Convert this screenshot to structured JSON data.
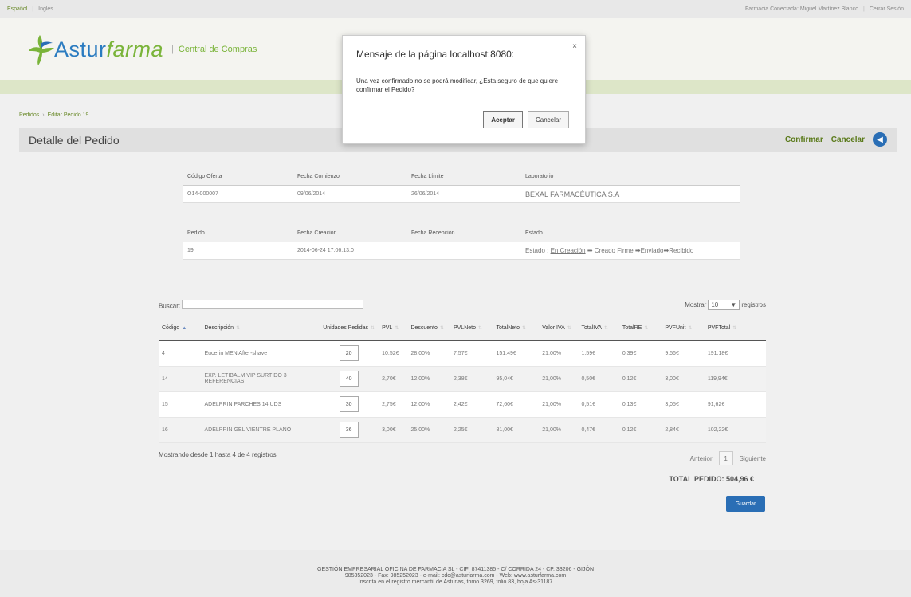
{
  "topbar": {
    "lang_es": "Español",
    "lang_en": "Inglés",
    "pharmacy_label": "Farmacia Conectada: Miguel Martínez Blanco",
    "logout": "Cerrar Sesión"
  },
  "header": {
    "logo_astur": "Astur",
    "logo_farma": "farma",
    "subtitle": "Central de Compras"
  },
  "breadcrumb": {
    "item1": "Pedidos",
    "item2": "Editar Pedido 19"
  },
  "titlebar": {
    "title": "Detalle del Pedido",
    "confirm": "Confirmar",
    "cancel": "Cancelar"
  },
  "offer": {
    "headers": [
      "Código Oferta",
      "Fecha Comienzo",
      "Fecha Límite",
      "Laboratorio"
    ],
    "values": [
      "O14-000007",
      "09/06/2014",
      "26/06/2014",
      "BEXAL FARMACÉUTICA S.A"
    ]
  },
  "order": {
    "headers": [
      "Pedido",
      "Fecha Creación",
      "Fecha Recepción",
      "Estado"
    ],
    "values": [
      "19",
      "2014-06-24 17:06:13.0",
      ""
    ],
    "estado_prefix": "Estado : ",
    "estado_current": "En Creación",
    "estado_rest": " ➡ Creado Firme ➡Enviado➡Recibido"
  },
  "table": {
    "search_label": "Buscar:",
    "show_label": "Mostrar",
    "show_value": "10",
    "records_label": "registros",
    "columns": [
      "Código",
      "Descripción",
      "Unidades Pedidas",
      "PVL",
      "Descuento",
      "PVLNeto",
      "TotalNeto",
      "Valor IVA",
      "TotalIVA",
      "TotalRE",
      "PVFUnit",
      "PVFTotal"
    ],
    "rows": [
      [
        "4",
        "Eucerin MEN After-shave",
        "20",
        "10,52€",
        "28,00%",
        "7,57€",
        "151,49€",
        "21,00%",
        "1,59€",
        "0,39€",
        "9,56€",
        "191,18€"
      ],
      [
        "14",
        "EXP. LETIBALM VIP SURTIDO 3 REFERENCIAS",
        "40",
        "2,70€",
        "12,00%",
        "2,38€",
        "95,04€",
        "21,00%",
        "0,50€",
        "0,12€",
        "3,00€",
        "119,94€"
      ],
      [
        "15",
        "ADELPRIN PARCHES 14 UDS",
        "30",
        "2,75€",
        "12,00%",
        "2,42€",
        "72,60€",
        "21,00%",
        "0,51€",
        "0,13€",
        "3,05€",
        "91,62€"
      ],
      [
        "16",
        "ADELPRIN GEL VIENTRE PLANO",
        "36",
        "3,00€",
        "25,00%",
        "2,25€",
        "81,00€",
        "21,00%",
        "0,47€",
        "0,12€",
        "2,84€",
        "102,22€"
      ]
    ],
    "info": "Mostrando desde 1 hasta 4 de 4 registros",
    "prev": "Anterior",
    "page": "1",
    "next": "Siguiente",
    "total": "TOTAL PEDIDO: 504,96 €",
    "save": "Guardar"
  },
  "footer": {
    "line1": "GESTIÓN EMPRESARIAL OFICINA DE FARMACIA SL - CIF: 87411385 - C/ CORRIDA 24 - CP. 33206 - GIJÓN",
    "line2": "985352023 - Fax: 985252023 - e-mail: cdc@asturfarma.com - Web: www.asturfarma.com",
    "line3": "Inscrita en el registro mercantil de Asturias, tomo 3269, folio 83, hoja As-31187"
  },
  "dialog": {
    "title": "Mensaje de la página localhost:8080:",
    "close": "×",
    "message": "Una vez confirmado no se podrá modificar, ¿Esta seguro de que quiere confirmar el Pedido?",
    "ok": "Aceptar",
    "cancel": "Cancelar"
  },
  "colors": {
    "brand_blue": "#2a6eb5",
    "brand_green": "#7ab43a"
  }
}
